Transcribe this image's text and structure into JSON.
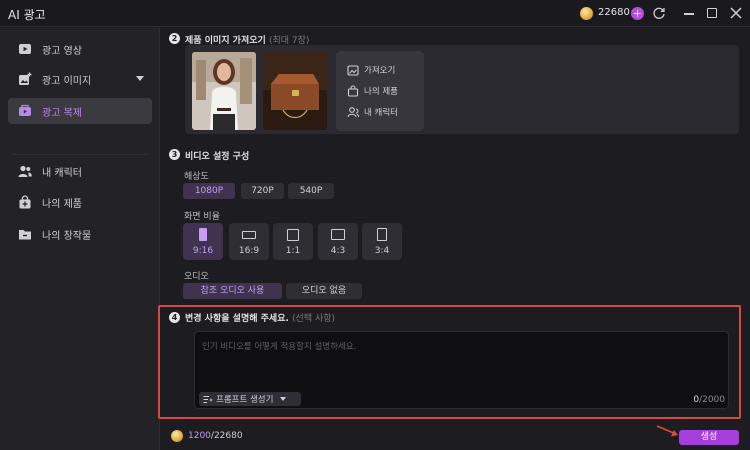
{
  "app": {
    "title": "AI 광고",
    "coins": "22680",
    "plus": "+"
  },
  "sidebar": {
    "items": [
      {
        "label": "광고 영상"
      },
      {
        "label": "광고 이미지"
      },
      {
        "label": "광고 복제"
      },
      {
        "label": "내 캐릭터"
      },
      {
        "label": "나의 제품"
      },
      {
        "label": "나의 창작물"
      }
    ],
    "active_index": 2
  },
  "section2": {
    "num": "2",
    "title": "제품 이미지 가져오기",
    "hint": "(최대 7장)",
    "sources": [
      {
        "label": "가져오기",
        "icon": "image-import-icon"
      },
      {
        "label": "나의 제품",
        "icon": "bag-icon"
      },
      {
        "label": "내 캐릭터",
        "icon": "person-icon"
      }
    ]
  },
  "section3": {
    "num": "3",
    "title": "비디오 설정 구성",
    "resolution_label": "해상도",
    "resolutions": [
      "1080P",
      "720P",
      "540P"
    ],
    "resolution_selected": "1080P",
    "ratio_label": "화면 비율",
    "ratios": [
      "9:16",
      "16:9",
      "1:1",
      "4:3",
      "3:4"
    ],
    "ratio_selected": "9:16",
    "audio_label": "오디오",
    "audio_options": [
      "참조 오디오 사용",
      "오디오 없음"
    ],
    "audio_selected": "참조 오디오 사용"
  },
  "section4": {
    "num": "4",
    "title": "변경 사항을 설명해 주세요.",
    "hint": "(선택 사항)",
    "placeholder": "인기 비디오를 어떻게 적용할지 설명하세요.",
    "prompt_button": "프롬프트 생성기",
    "count_current": "0",
    "count_max": "/2000"
  },
  "footer": {
    "cost_current": "1200",
    "cost_total": "/22680",
    "generate": "생성"
  },
  "colors": {
    "accent": "#a53fdc",
    "highlight": "#d24b3c",
    "selected_text": "#c79cf2"
  }
}
